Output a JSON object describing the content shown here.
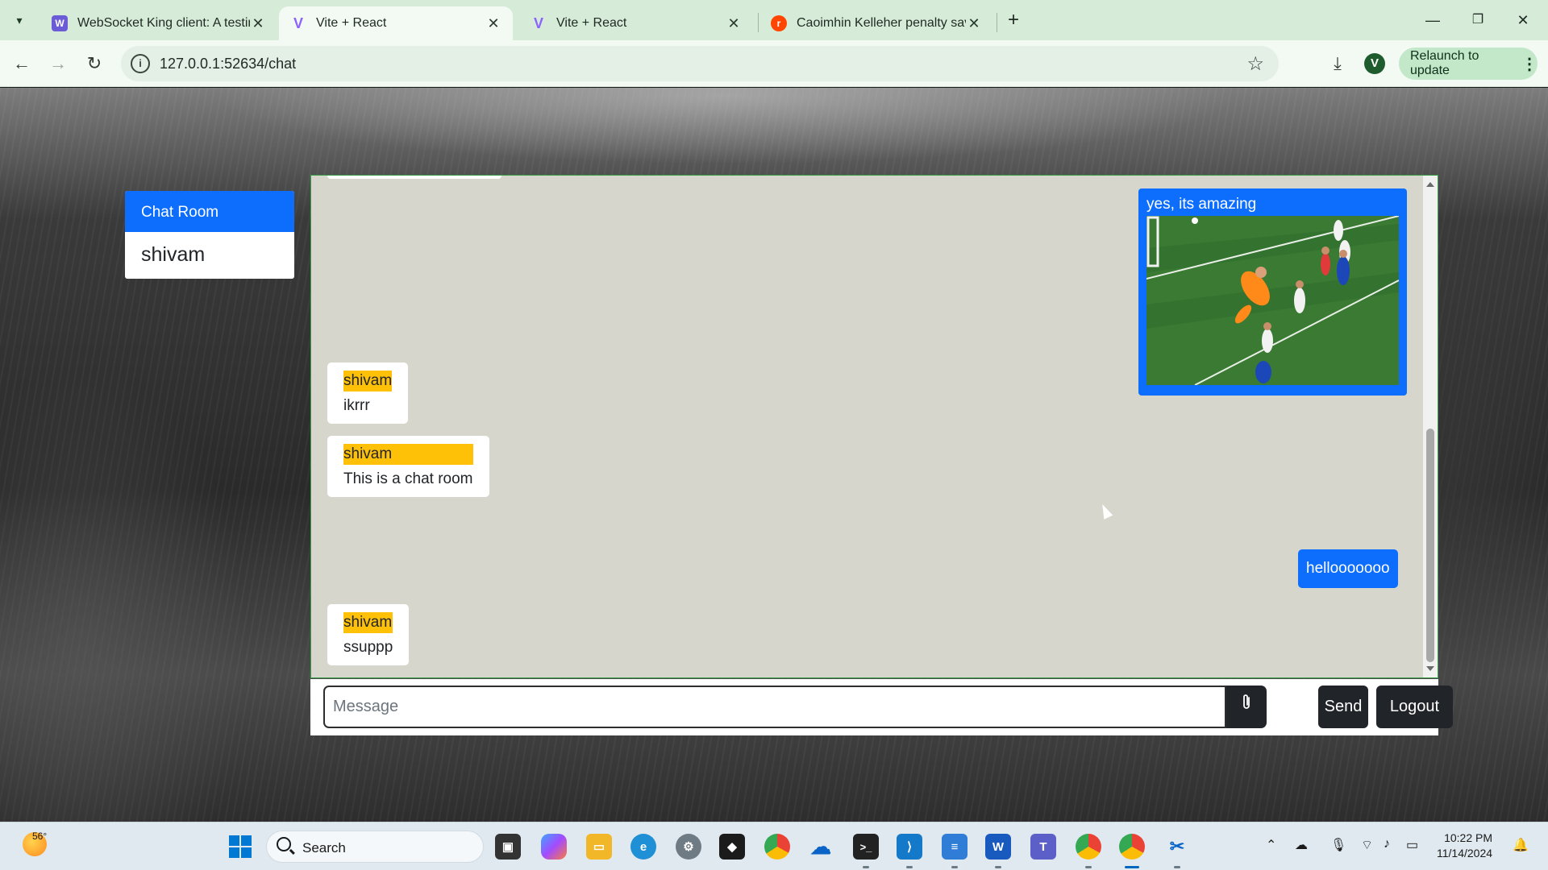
{
  "browser": {
    "tabs": [
      {
        "title": "WebSocket King client: A testin",
        "favicon": "websocket-king-icon",
        "active": false
      },
      {
        "title": "Vite + React",
        "favicon": "vite-icon",
        "active": true
      },
      {
        "title": "Vite + React",
        "favicon": "vite-icon",
        "active": false
      },
      {
        "title": "Caoimhin Kelleher penalty save",
        "favicon": "reddit-icon",
        "active": false
      }
    ],
    "url": "127.0.0.1:52634/chat",
    "profile_initial": "V",
    "relaunch_label": "Relaunch to update"
  },
  "sidebar": {
    "header": "Chat Room",
    "users": [
      "shivam"
    ]
  },
  "chat": {
    "messages": [
      {
        "direction": "out",
        "type": "image",
        "text": "yes, its amazing"
      },
      {
        "direction": "in",
        "sender": "shivam",
        "text": "ikrrr"
      },
      {
        "direction": "in",
        "sender": "shivam",
        "text": "This is a chat room"
      },
      {
        "direction": "out",
        "type": "text",
        "text": "hellooooooo"
      },
      {
        "direction": "in",
        "sender": "shivam",
        "text": "ssuppp"
      }
    ]
  },
  "composer": {
    "placeholder": "Message",
    "attach_icon": "paperclip-icon",
    "send_label": "Send",
    "logout_label": "Logout"
  },
  "taskbar": {
    "weather_temp": "56°",
    "search_label": "Search",
    "time": "10:22 PM",
    "date": "11/14/2024"
  },
  "colors": {
    "primary": "#0d6efd",
    "sender_highlight": "#ffc107",
    "chat_background": "#d6d6cc",
    "dark_button": "#212529"
  }
}
